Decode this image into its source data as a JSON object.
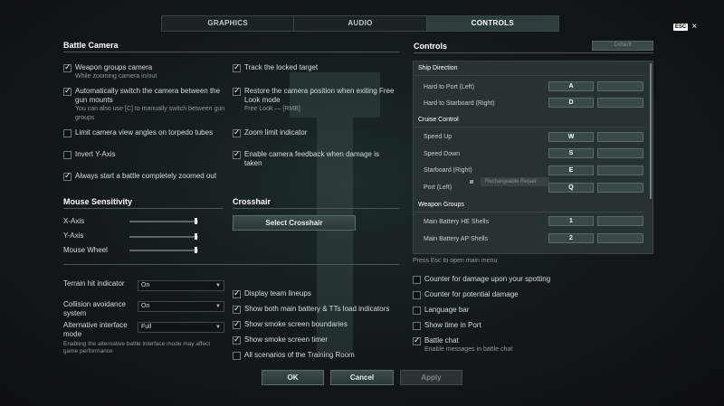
{
  "tabs": [
    {
      "label": "GRAPHICS",
      "active": false
    },
    {
      "label": "AUDIO",
      "active": false
    },
    {
      "label": "CONTROLS",
      "active": true
    }
  ],
  "esc": {
    "key": "ESC",
    "close": "×"
  },
  "battle_camera": {
    "title": "Battle Camera",
    "left_options": [
      {
        "label": "Weapon groups camera",
        "sub": "While zooming camera in/out",
        "checked": true
      },
      {
        "label": "Automatically switch the camera between the gun mounts",
        "sub": "You can also use [C] to manually switch between gun groups",
        "checked": true
      },
      {
        "label": "Limit camera view angles on torpedo tubes",
        "sub": "",
        "checked": false
      },
      {
        "label": "Invert Y-Axis",
        "sub": "",
        "checked": false
      },
      {
        "label": "Always start a battle completely zoomed out",
        "sub": "",
        "checked": true
      }
    ],
    "right_options": [
      {
        "label": "Track the locked target",
        "sub": "",
        "checked": true
      },
      {
        "label": "Restore the camera position when exiting Free Look mode",
        "sub": "Free Look — [RMB]",
        "checked": true
      },
      {
        "label": "Zoom limit indicator",
        "sub": "",
        "checked": true
      },
      {
        "label": "Enable camera feedback when damage is taken",
        "sub": "",
        "checked": true
      }
    ]
  },
  "mouse_sensitivity": {
    "title": "Mouse Sensitivity",
    "sliders": [
      {
        "label": "X-Axis",
        "value": 0.96
      },
      {
        "label": "Y-Axis",
        "value": 0.96
      },
      {
        "label": "Mouse Wheel",
        "value": 0.96
      }
    ]
  },
  "crosshair": {
    "title": "Crosshair",
    "button": "Select Crosshair"
  },
  "dropdowns": [
    {
      "label": "Terrain hit indicator",
      "value": "On"
    },
    {
      "label": "Collision avoidance system",
      "value": "On"
    },
    {
      "label": "Alternative interface mode",
      "value": "Full"
    }
  ],
  "alt_note": "Enabling the alternative battle interface mode may affect game performance",
  "middle_options": [
    {
      "label": "Display team lineups",
      "checked": true
    },
    {
      "label": "Show both main battery & TTs load indicators",
      "checked": true
    },
    {
      "label": "Show smoke screen boundaries",
      "checked": true
    },
    {
      "label": "Show smoke screen timer",
      "checked": true
    },
    {
      "label": "All scenarios of the Training Room",
      "checked": false
    }
  ],
  "controls": {
    "title": "Controls",
    "default_label": "Default",
    "groups": [
      {
        "name": "Ship Direction",
        "actions": [
          {
            "label": "Hard to Port (Left)",
            "key": "A"
          },
          {
            "label": "Hard to Starboard (Right)",
            "key": "D"
          }
        ]
      },
      {
        "name": "Cruise Control",
        "actions": [
          {
            "label": "Speed Up",
            "key": "W"
          },
          {
            "label": "Speed Down",
            "key": "S"
          },
          {
            "label": "Starboard (Right)",
            "key": "E"
          },
          {
            "label": "Port (Left)",
            "key": "Q"
          }
        ]
      },
      {
        "name": "Weapon Groups",
        "actions": [
          {
            "label": "Main Battery HE Shells",
            "key": "1"
          },
          {
            "label": "Main Battery AP Shells",
            "key": "2"
          }
        ]
      }
    ],
    "tooltip": "Rechargeable Repair",
    "press_esc": "Press Esc to open main menu"
  },
  "right_options": [
    {
      "label": "Counter for damage upon your spotting",
      "sub": "",
      "checked": false
    },
    {
      "label": "Counter for potential damage",
      "sub": "",
      "checked": false
    },
    {
      "label": "Language bar",
      "sub": "",
      "checked": false
    },
    {
      "label": "Show time in Port",
      "sub": "",
      "checked": false
    },
    {
      "label": "Battle chat",
      "sub": "Enable messages in battle chat",
      "checked": true
    }
  ],
  "footer": {
    "ok": "OK",
    "cancel": "Cancel",
    "apply": "Apply"
  }
}
